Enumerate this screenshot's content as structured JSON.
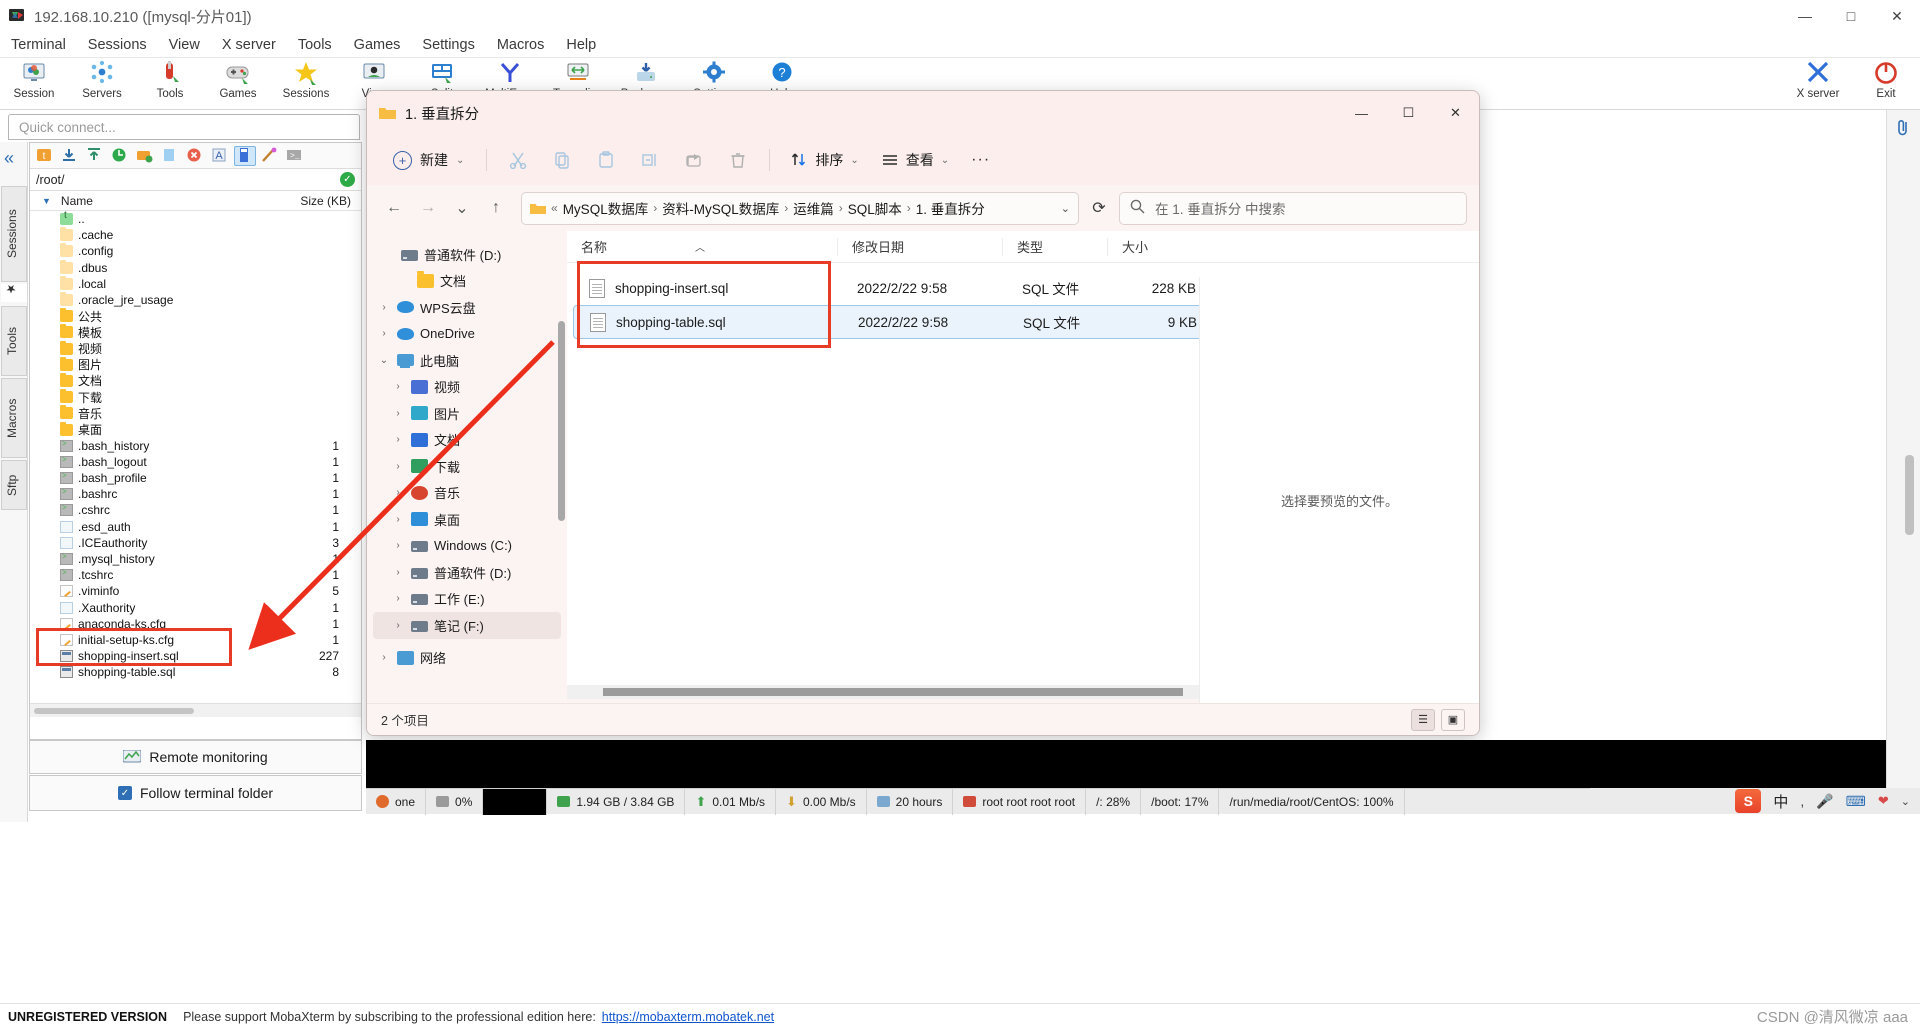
{
  "mobaxterm": {
    "title": "192.168.10.210 ([mysql-分片01])",
    "window_buttons": {
      "minimize": "—",
      "maximize": "□",
      "close": "✕"
    },
    "menu": [
      "Terminal",
      "Sessions",
      "View",
      "X server",
      "Tools",
      "Games",
      "Settings",
      "Macros",
      "Help"
    ],
    "toolbar": [
      {
        "label": "Session",
        "icon": "session-icon"
      },
      {
        "label": "Servers",
        "icon": "servers-icon"
      },
      {
        "label": "Tools",
        "icon": "tools-icon"
      },
      {
        "label": "Games",
        "icon": "games-icon"
      },
      {
        "label": "Sessions",
        "icon": "star-icon"
      },
      {
        "label": "View",
        "icon": "view-icon"
      },
      {
        "label": "Split",
        "icon": "split-icon"
      },
      {
        "label": "MultiExec",
        "icon": "multiexec-icon"
      },
      {
        "label": "Tunneling",
        "icon": "tunneling-icon"
      },
      {
        "label": "Packages",
        "icon": "packages-icon"
      },
      {
        "label": "Settings",
        "icon": "settings-icon"
      },
      {
        "label": "Help",
        "icon": "help-icon"
      }
    ],
    "toolbar_right": [
      {
        "label": "X server",
        "icon": "xserver-icon"
      },
      {
        "label": "Exit",
        "icon": "exit-icon"
      }
    ],
    "quick_connect_placeholder": "Quick connect...",
    "vertical_tabs": [
      "Sessions",
      "Tools",
      "Macros",
      "Sftp"
    ],
    "sftp": {
      "path": "/root/",
      "columns": {
        "name": "Name",
        "size": "Size (KB)"
      },
      "files": [
        {
          "name": "..",
          "size": "",
          "icon": "up-icon"
        },
        {
          "name": ".cache",
          "size": "",
          "icon": "folder-pale-icon"
        },
        {
          "name": ".config",
          "size": "",
          "icon": "folder-pale-icon"
        },
        {
          "name": ".dbus",
          "size": "",
          "icon": "folder-pale-icon"
        },
        {
          "name": ".local",
          "size": "",
          "icon": "folder-pale-icon"
        },
        {
          "name": ".oracle_jre_usage",
          "size": "",
          "icon": "folder-pale-icon"
        },
        {
          "name": "公共",
          "size": "",
          "icon": "folder-icon"
        },
        {
          "name": "模板",
          "size": "",
          "icon": "folder-icon"
        },
        {
          "name": "视频",
          "size": "",
          "icon": "folder-icon"
        },
        {
          "name": "图片",
          "size": "",
          "icon": "folder-icon"
        },
        {
          "name": "文档",
          "size": "",
          "icon": "folder-icon"
        },
        {
          "name": "下载",
          "size": "",
          "icon": "folder-icon"
        },
        {
          "name": "音乐",
          "size": "",
          "icon": "folder-icon"
        },
        {
          "name": "桌面",
          "size": "",
          "icon": "folder-icon"
        },
        {
          "name": ".bash_history",
          "size": "1",
          "icon": "terminal-file-icon"
        },
        {
          "name": ".bash_logout",
          "size": "1",
          "icon": "terminal-file-icon"
        },
        {
          "name": ".bash_profile",
          "size": "1",
          "icon": "terminal-file-icon"
        },
        {
          "name": ".bashrc",
          "size": "1",
          "icon": "terminal-file-icon"
        },
        {
          "name": ".cshrc",
          "size": "1",
          "icon": "terminal-file-icon"
        },
        {
          "name": ".esd_auth",
          "size": "1",
          "icon": "document-icon"
        },
        {
          "name": ".ICEauthority",
          "size": "3",
          "icon": "document-icon"
        },
        {
          "name": ".mysql_history",
          "size": "1",
          "icon": "terminal-file-icon"
        },
        {
          "name": ".tcshrc",
          "size": "1",
          "icon": "terminal-file-icon"
        },
        {
          "name": ".viminfo",
          "size": "5",
          "icon": "config-icon"
        },
        {
          "name": ".Xauthority",
          "size": "1",
          "icon": "document-icon"
        },
        {
          "name": "anaconda-ks.cfg",
          "size": "1",
          "icon": "config-icon"
        },
        {
          "name": "initial-setup-ks.cfg",
          "size": "1",
          "icon": "config-icon"
        },
        {
          "name": "shopping-insert.sql",
          "size": "227",
          "icon": "sql-icon"
        },
        {
          "name": "shopping-table.sql",
          "size": "8",
          "icon": "sql-icon"
        }
      ]
    },
    "remote_monitoring_label": "Remote monitoring",
    "follow_terminal_label": "Follow terminal folder",
    "status_bar": [
      {
        "label": "one",
        "icon": "session-dot-icon"
      },
      {
        "label": "0%",
        "icon": "cpu-icon"
      },
      {
        "label": "",
        "icon": "black-cell"
      },
      {
        "label": "1.94 GB / 3.84 GB",
        "icon": "memory-icon"
      },
      {
        "label": "0.01 Mb/s",
        "icon": "upload-icon"
      },
      {
        "label": "0.00 Mb/s",
        "icon": "download-icon"
      },
      {
        "label": "20 hours",
        "icon": "uptime-icon"
      },
      {
        "label": "root  root  root  root",
        "icon": "user-icon"
      },
      {
        "label": "/: 28%",
        "icon": "disk-icon"
      },
      {
        "label": "/boot: 17%",
        "icon": "disk-icon"
      },
      {
        "label": "/run/media/root/CentOS: 100%",
        "icon": "disk-icon"
      }
    ],
    "tray": {
      "ime": "中",
      "items": [
        "sogou-icon",
        "ime-icon",
        "mic-icon",
        "keyboard-icon",
        "heart-icon",
        "chevron-icon"
      ]
    },
    "footer": {
      "unregistered": "UNREGISTERED VERSION",
      "support_text": "Please support MobaXterm by subscribing to the professional edition here:",
      "link": "https://mobaxterm.mobatek.net"
    },
    "watermark": "CSDN @清风微凉 aaa"
  },
  "explorer": {
    "title": "1. 垂直拆分",
    "window_buttons": {
      "minimize": "—",
      "maximize": "☐",
      "close": "✕"
    },
    "command_bar": {
      "new_label": "新建",
      "cut_icon": "cut-icon",
      "copy_icon": "copy-icon",
      "paste_icon": "paste-icon",
      "rename_icon": "rename-icon",
      "share_icon": "share-icon",
      "delete_icon": "delete-icon",
      "sort_label": "排序",
      "view_label": "查看",
      "more_label": "···"
    },
    "address": {
      "prefix": "«",
      "crumbs": [
        "MySQL数据库",
        "资料-MySQL数据库",
        "运维篇",
        "SQL脚本",
        "1. 垂直拆分"
      ],
      "separator": "›"
    },
    "search_placeholder": "在 1. 垂直拆分 中搜索",
    "nav_tree": [
      {
        "label": "普通软件 (D:)",
        "icon": "drive-icon",
        "chevron": "",
        "indent": 1
      },
      {
        "label": "文档",
        "icon": "folder-icon",
        "chevron": "",
        "indent": 2
      },
      {
        "label": "WPS云盘",
        "icon": "cloud-icon",
        "chevron": "›",
        "indent": 0
      },
      {
        "label": "OneDrive",
        "icon": "cloud-icon",
        "chevron": "›",
        "indent": 0
      },
      {
        "label": "此电脑",
        "icon": "pc-icon",
        "chevron": "⌄",
        "indent": 0
      },
      {
        "label": "视频",
        "icon": "videos-icon",
        "chevron": "›",
        "indent": 1
      },
      {
        "label": "图片",
        "icon": "pictures-icon",
        "chevron": "›",
        "indent": 1
      },
      {
        "label": "文档",
        "icon": "documents-icon",
        "chevron": "›",
        "indent": 1
      },
      {
        "label": "下载",
        "icon": "downloads-icon",
        "chevron": "›",
        "indent": 1
      },
      {
        "label": "音乐",
        "icon": "music-icon",
        "chevron": "›",
        "indent": 1
      },
      {
        "label": "桌面",
        "icon": "desktop-icon",
        "chevron": "›",
        "indent": 1
      },
      {
        "label": "Windows (C:)",
        "icon": "drive-icon",
        "chevron": "›",
        "indent": 1
      },
      {
        "label": "普通软件 (D:)",
        "icon": "drive-icon",
        "chevron": "›",
        "indent": 1
      },
      {
        "label": "工作 (E:)",
        "icon": "drive-icon",
        "chevron": "›",
        "indent": 1
      },
      {
        "label": "笔记 (F:)",
        "icon": "drive-icon",
        "chevron": "›",
        "indent": 1,
        "selected": true
      },
      {
        "label": "网络",
        "icon": "network-icon",
        "chevron": "›",
        "indent": 0
      }
    ],
    "file_list": {
      "columns": [
        "名称",
        "修改日期",
        "类型",
        "大小"
      ],
      "rows": [
        {
          "name": "shopping-insert.sql",
          "date": "2022/2/22 9:58",
          "type": "SQL 文件",
          "size": "228 KB",
          "selected": false
        },
        {
          "name": "shopping-table.sql",
          "date": "2022/2/22 9:58",
          "type": "SQL 文件",
          "size": "9 KB",
          "selected": true
        }
      ]
    },
    "preview_text": "选择要预览的文件。",
    "status_count": "2 个项目",
    "view_toggles": [
      "list-view-icon",
      "detail-view-icon"
    ]
  },
  "annotations": {
    "color": "#e83b26",
    "boxes": [
      "explorer-files-box",
      "sftp-files-box"
    ],
    "arrow": "red-arrow-pointing-left-down"
  }
}
